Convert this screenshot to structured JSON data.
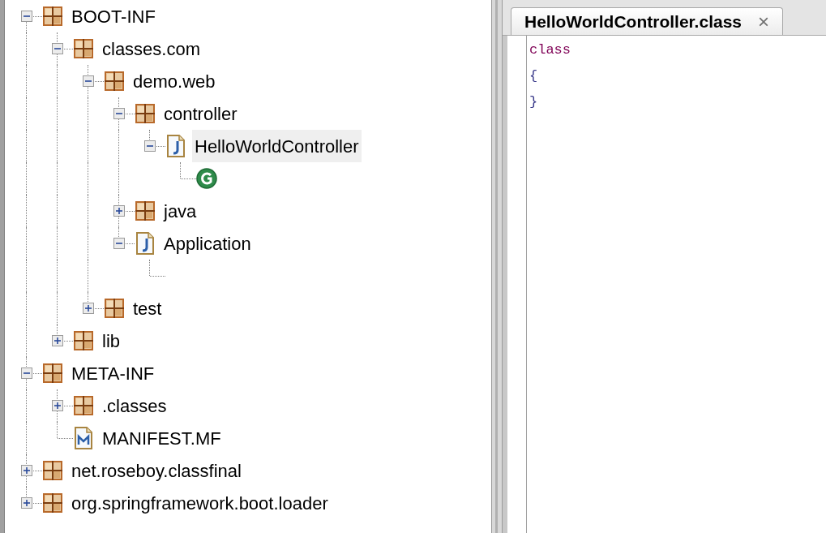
{
  "tree": [
    {
      "kind": "package",
      "label": "BOOT-INF",
      "expanded": true,
      "children": [
        {
          "kind": "package",
          "label": "classes.com",
          "expanded": true,
          "children": [
            {
              "kind": "package",
              "label": "demo.web",
              "expanded": true,
              "children": [
                {
                  "kind": "package",
                  "label": "controller",
                  "expanded": true,
                  "children": [
                    {
                      "kind": "java",
                      "label": "HelloWorldController",
                      "expanded": true,
                      "selected": true,
                      "children": [
                        {
                          "kind": "class"
                        }
                      ]
                    }
                  ]
                },
                {
                  "kind": "package",
                  "label": "java",
                  "expanded": false
                },
                {
                  "kind": "java",
                  "label": "Application",
                  "expanded": true,
                  "selected": false,
                  "children": [
                    {
                      "kind": "empty"
                    }
                  ]
                }
              ]
            },
            {
              "kind": "package",
              "label": "test",
              "expanded": false
            }
          ]
        },
        {
          "kind": "package",
          "label": "lib",
          "expanded": false
        }
      ]
    },
    {
      "kind": "package",
      "label": "META-INF",
      "expanded": true,
      "children": [
        {
          "kind": "package",
          "label": ".classes",
          "expanded": false
        },
        {
          "kind": "manifest",
          "label": "MANIFEST.MF"
        }
      ]
    },
    {
      "kind": "package",
      "label": "net.roseboy.classfinal",
      "expanded": false
    },
    {
      "kind": "package",
      "label": "org.springframework.boot.loader",
      "expanded": false
    }
  ],
  "editor": {
    "tab": {
      "title": "HelloWorldController.class",
      "close": "×"
    },
    "lines": [
      {
        "kind": "keyword",
        "text": "class"
      },
      {
        "kind": "plain",
        "text": "{"
      },
      {
        "kind": "plain",
        "text": "}"
      }
    ]
  }
}
